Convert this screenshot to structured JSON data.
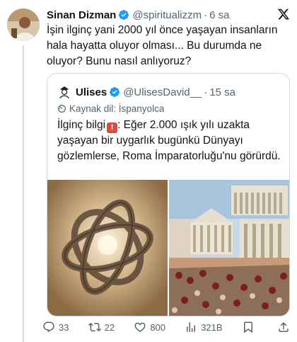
{
  "tweet": {
    "author_name": "Sinan Dizman",
    "handle": "@spiritualizzm",
    "separator": "·",
    "time": "6 sa",
    "text": "İşin ilginç yani 2000 yıl önce yaşayan insanların hala hayatta oluyor olması... Bu durumda ne oluyor? Bunu nasıl anlıyoruz?"
  },
  "quote": {
    "author_name": "Ulises",
    "handle": "@UlisesDavid__",
    "separator": "·",
    "time": "15 sa",
    "language_label": "Kaynak dil: İspanyolca",
    "text_prefix": "İlginç bilgi",
    "text_body": ": Eğer 2.000 ışık yılı uzakta yaşayan bir uygarlık bugünkü Dünyayı gözlemlerse, Roma İmparatorluğu'nu görürdü.",
    "images": [
      "ring-structure-image",
      "roman-forum-image"
    ]
  },
  "actions": {
    "replies": "33",
    "retweets": "22",
    "likes": "800",
    "views": "321B"
  },
  "colors": {
    "verified_blue": "#1d9bf0",
    "secondary_text": "#536471",
    "border": "#cfd9de"
  },
  "icons": [
    "verified-badge-icon",
    "x-logo-icon",
    "translate-icon",
    "reply-icon",
    "retweet-icon",
    "like-icon",
    "views-icon",
    "bookmark-icon",
    "share-icon"
  ]
}
